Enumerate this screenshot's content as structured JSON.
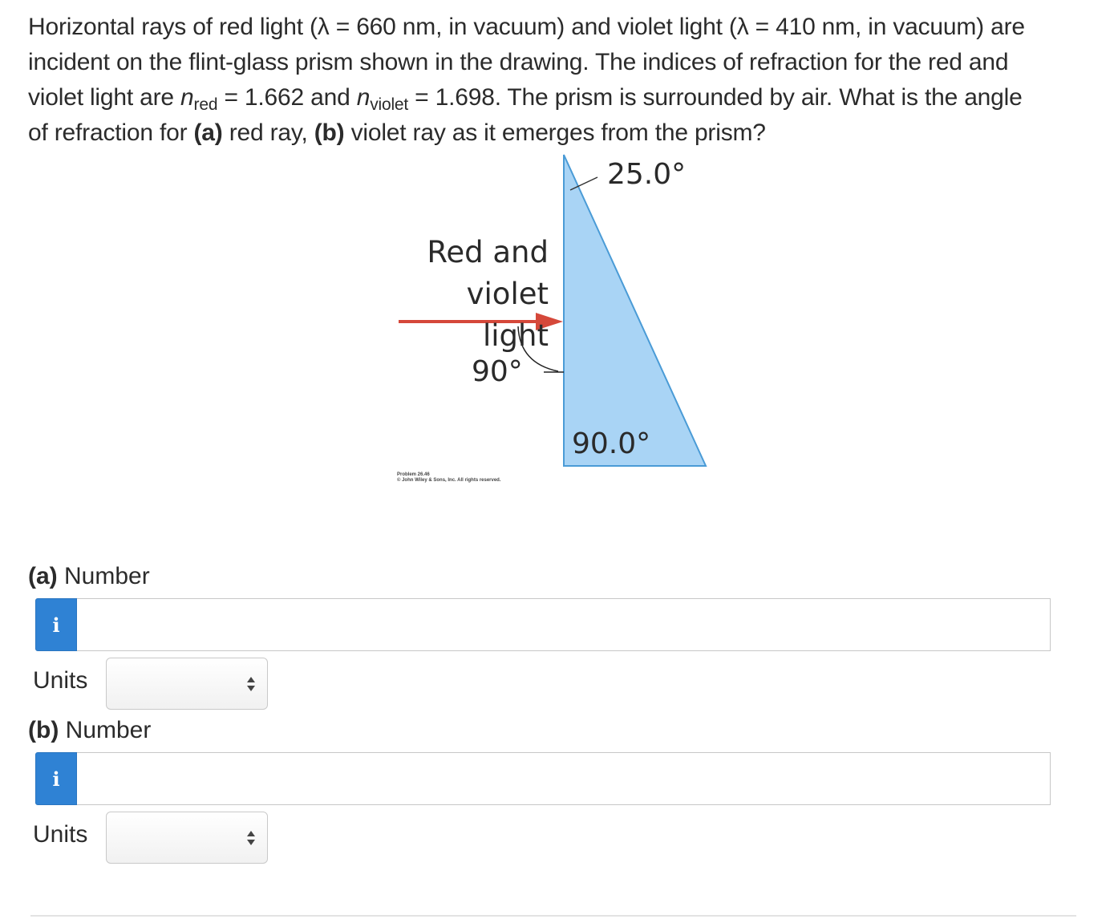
{
  "problem": {
    "line1": "Horizontal rays of red light (λ = 660 nm, in vacuum) and violet light (λ = 410 nm, in vacuum) are",
    "line2": "incident on the flint-glass prism shown in the drawing. The indices of refraction for the red and",
    "line3_pre": "violet light are ",
    "n_symbol": "n",
    "sub_red": "red",
    "line3_mid": " = 1.662 and ",
    "sub_violet": "violet",
    "line3_post": " = 1.698. The prism is surrounded by air. What is the angle",
    "line4_pre": "of refraction for ",
    "part_a_tag": "(a)",
    "line4_mid": " red ray, ",
    "part_b_tag": "(b)",
    "line4_post": " violet ray as it emerges from the prism?"
  },
  "figure": {
    "top_angle": "25.0°",
    "light_label_line1": "Red and",
    "light_label_line2": "violet light",
    "incidence_angle": "90°",
    "corner_angle": "90.0°",
    "credit_line1": "Problem 26.46",
    "credit_line2": "© John Wiley & Sons, Inc. All rights reserved.",
    "colors": {
      "prism_fill": "#a9d4f5",
      "prism_edge": "#4a9bd6",
      "ray": "#d5483a"
    }
  },
  "parts": [
    {
      "tag": "(a)",
      "label": "Number",
      "info_icon": "i",
      "value": "",
      "units_label": "Units",
      "units_selected": ""
    },
    {
      "tag": "(b)",
      "label": "Number",
      "info_icon": "i",
      "value": "",
      "units_label": "Units",
      "units_selected": ""
    }
  ],
  "colors": {
    "info_button": "#2f82d4",
    "text": "#2b2b2b"
  }
}
